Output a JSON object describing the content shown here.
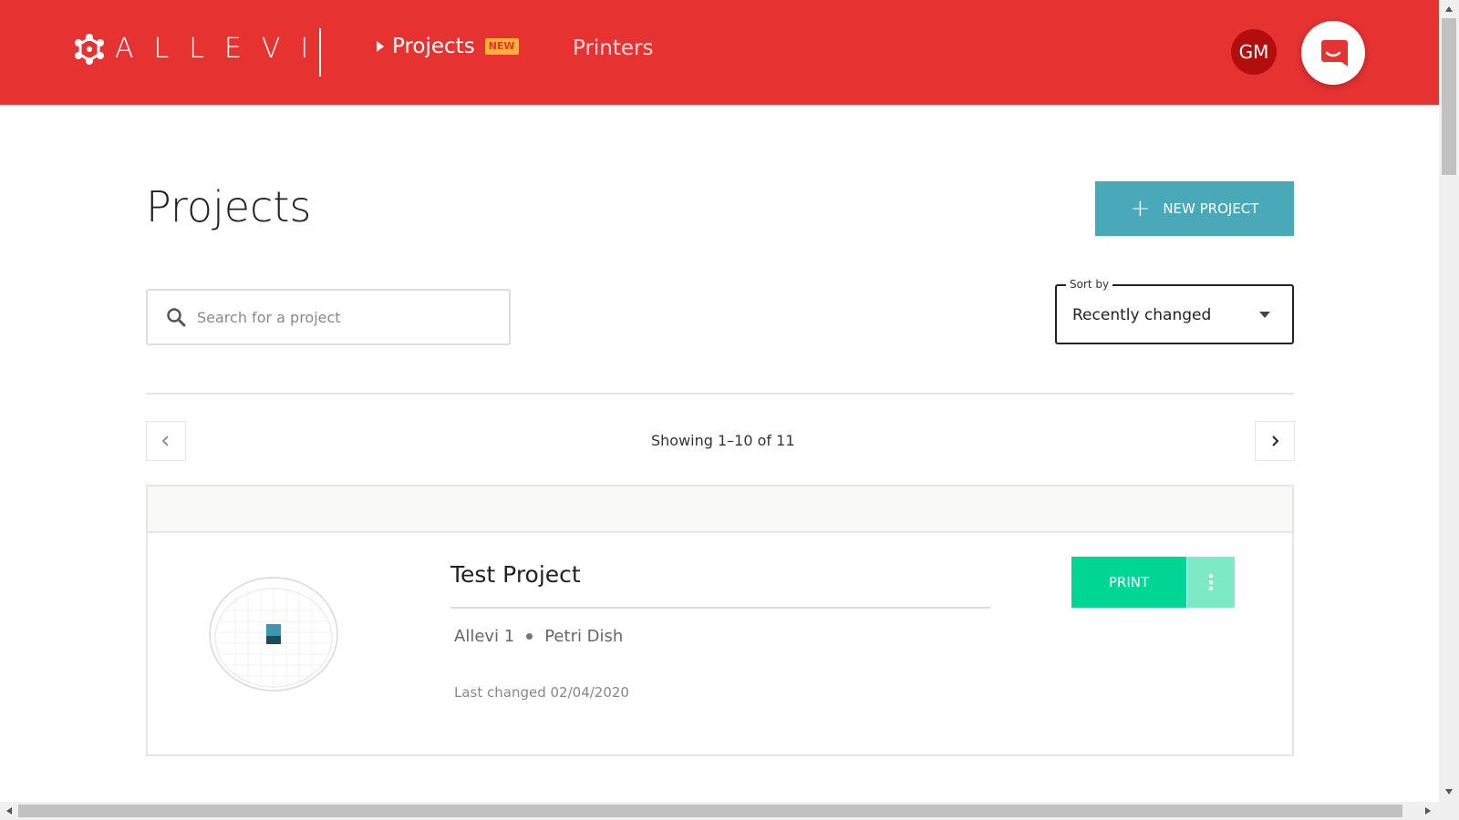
{
  "header": {
    "brand": "ALLEVI",
    "nav": {
      "projects_label": "Projects",
      "new_badge": "NEW",
      "printers_label": "Printers"
    },
    "avatar_initials": "GM",
    "colors": {
      "primary": "#e73232",
      "avatar": "#b30e0e",
      "badge": "#f5b335"
    }
  },
  "page": {
    "title": "Projects",
    "new_project_label": "NEW PROJECT",
    "search": {
      "placeholder": "Search for a project",
      "value": ""
    },
    "sort": {
      "label": "Sort by",
      "value": "Recently changed"
    },
    "pagination": {
      "text": "Showing 1–10 of 11"
    }
  },
  "projects": [
    {
      "name": "Test Project",
      "printer": "Allevi 1",
      "container": "Petri Dish",
      "last_changed": "Last changed 02/04/2020",
      "print_label": "PRINT"
    }
  ],
  "icons": {
    "logo": "allevi-logo-icon",
    "search": "search-icon",
    "chevron_left": "chevron-left-icon",
    "chevron_right": "chevron-right-icon",
    "more": "more-vertical-icon",
    "chat": "chat-icon"
  },
  "colors": {
    "accent": "#4aa9b8",
    "print": "#00d693",
    "more": "#7ee9c5"
  }
}
